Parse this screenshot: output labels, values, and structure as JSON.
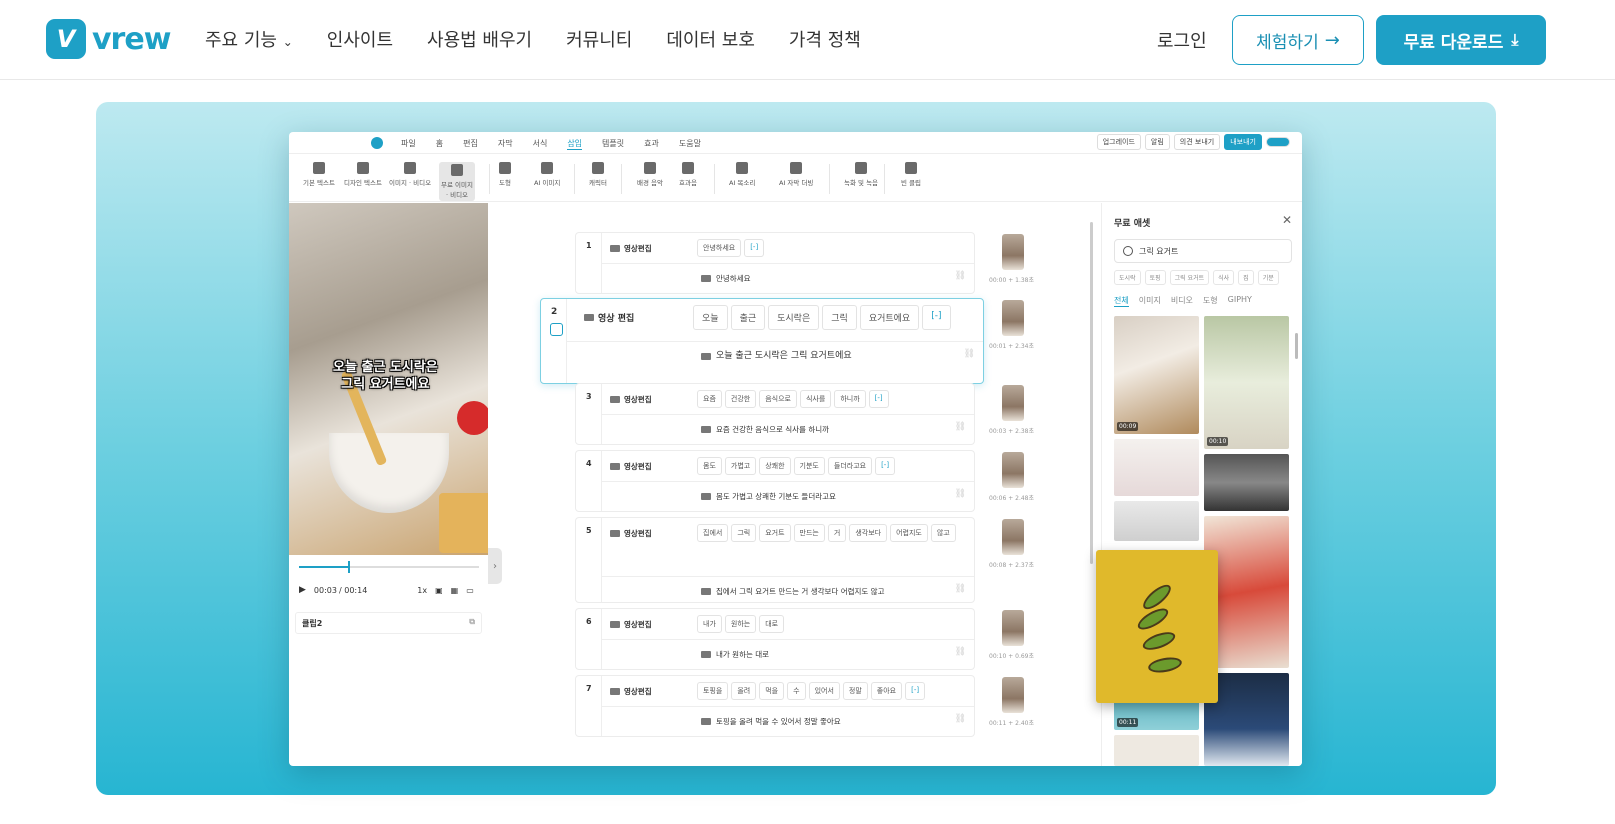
{
  "nav": {
    "logo_text": "vrew",
    "logo_mark": "V",
    "menu": [
      "주요 기능",
      "인사이트",
      "사용법 배우기",
      "커뮤니티",
      "데이터 보호",
      "가격 정책"
    ],
    "menu_dropdown_icon": "chevron-down-icon",
    "login": "로그인",
    "try_button": "체험하기",
    "download_button": "무료 다운로드",
    "brand_color": "#1ea0c6"
  },
  "app": {
    "top_menu": [
      "파일",
      "홈",
      "편집",
      "자막",
      "서식",
      "삽입",
      "템플릿",
      "효과",
      "도움말"
    ],
    "active_menu": "삽입",
    "top_right": [
      "업그레이드",
      "알림",
      "의견 보내기",
      "내보내기"
    ],
    "tools": [
      "기본 텍스트",
      "디자인 텍스트",
      "이미지 · 비디오",
      "무료 이미지 · 비디오",
      "도형",
      "AI 이미지",
      "캐릭터",
      "배경 음악",
      "효과음",
      "AI 목소리",
      "AI 자막 더빙",
      "녹화 및 녹음",
      "빈 클립"
    ],
    "video_subtitle": [
      "오늘 출근 도시락은",
      "그릭 요거트에요"
    ],
    "player": {
      "current": "00:03",
      "total": "/ 00:14",
      "speed": "1x",
      "progress": 0.27
    },
    "clip_name": "클립2",
    "clips": [
      {
        "num": "1",
        "label": "영상편집",
        "words": [
          "안녕하세요",
          "[-]"
        ],
        "subtitle": "안녕하세요",
        "time": "00:00 + 1.38초"
      },
      {
        "num": "2",
        "label": "영상 편집",
        "words": [
          "오늘",
          "출근",
          "도시락은",
          "그릭",
          "요거트에요",
          "[-]"
        ],
        "subtitle": "오늘 출근 도시락은 그릭 요거트에요",
        "time": "00:01 + 2.34초"
      },
      {
        "num": "3",
        "label": "영상편집",
        "words": [
          "요즘",
          "건강한",
          "음식으로",
          "식사를",
          "하니까",
          "[-]"
        ],
        "subtitle": "요즘 건강한 음식으로 식사를 하니까",
        "time": "00:03 + 2.38초"
      },
      {
        "num": "4",
        "label": "영상편집",
        "words": [
          "몸도",
          "가볍고",
          "상쾌한",
          "기분도",
          "들더라고요",
          "[-]"
        ],
        "subtitle": "몸도 가볍고 상쾌한 기분도 들더라고요",
        "time": "00:06 + 2.48초"
      },
      {
        "num": "5",
        "label": "영상편집",
        "words": [
          "집에서",
          "그릭",
          "요거트",
          "만드는",
          "거",
          "생각보다",
          "어렵지도",
          "않고"
        ],
        "subtitle": "집에서 그릭 요거트 만드는 거 생각보다 어렵지도 않고",
        "time": "00:08 + 2.37초"
      },
      {
        "num": "6",
        "label": "영상편집",
        "words": [
          "내가",
          "원하는",
          "대로"
        ],
        "subtitle": "내가 원하는 대로",
        "time": "00:10 + 0.69초"
      },
      {
        "num": "7",
        "label": "영상편집",
        "words": [
          "토핑을",
          "올려",
          "먹을",
          "수",
          "있어서",
          "정말",
          "좋아요",
          "[-]"
        ],
        "subtitle": "토핑을 올려 먹을 수 있어서 정말 좋아요",
        "time": "00:11 + 2.40초"
      }
    ],
    "assets_panel": {
      "title": "무료 애셋",
      "search_value": "그릭 요거트",
      "chips": [
        "도시락",
        "토핑",
        "그릭 요거트",
        "식사",
        "집",
        "기분"
      ],
      "tabs": [
        "전체",
        "이미지",
        "비디오",
        "도형",
        "GIPHY"
      ],
      "active_tab": "전체",
      "durations": [
        "00:09",
        "00:10",
        "00:11"
      ]
    }
  }
}
